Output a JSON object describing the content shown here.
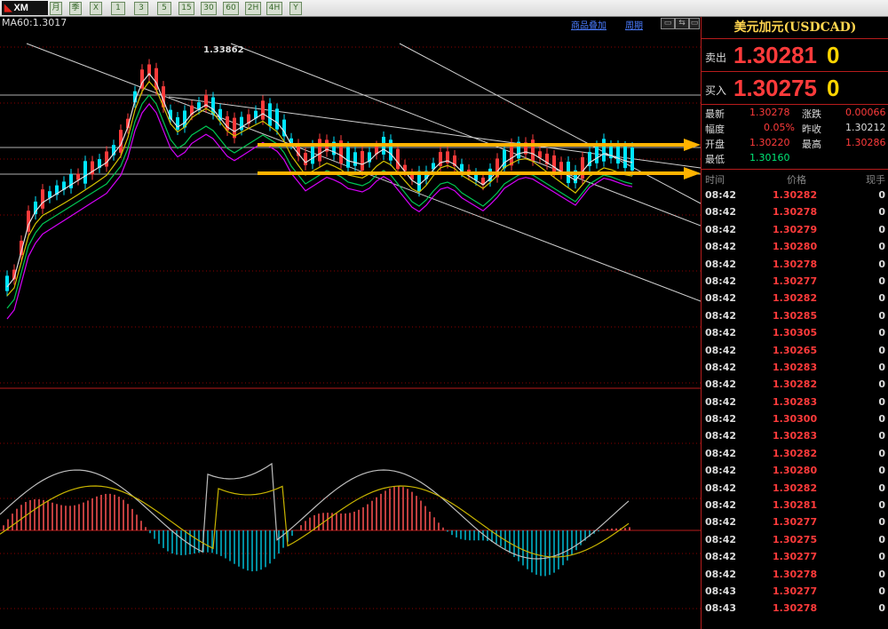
{
  "toolbar": {
    "logo_text": "XM",
    "buttons": [
      "月",
      "季",
      "X",
      "1",
      "3",
      "5",
      "15",
      "30",
      "60",
      "2H",
      "4H",
      "Y"
    ]
  },
  "chart": {
    "ma_label": "MA60:1.3017",
    "peak_label": "1.33862",
    "link_add_product": "商品叠加",
    "link_cycle": "周期",
    "colors": {
      "up_candle": "#00e5ff",
      "down_candle": "#ff3b3b",
      "arrow": "#ffb300",
      "grid": "#8b0000",
      "hline": "#b0b0b0"
    }
  },
  "panel": {
    "title": "美元加元(USDCAD)",
    "sell_label": "卖出",
    "sell_price": "1.30281",
    "sell_size": "0",
    "buy_label": "买入",
    "buy_price": "1.30275",
    "buy_size": "0",
    "stats": {
      "latest_label": "最新",
      "latest_value": "1.30278",
      "change_label": "涨跌",
      "change_value": "0.00066",
      "amplitude_label": "幅度",
      "amplitude_value": "0.05%",
      "prev_close_label": "昨收",
      "prev_close_value": "1.30212",
      "open_label": "开盘",
      "open_value": "1.30220",
      "high_label": "最高",
      "high_value": "1.30286",
      "low_label": "最低",
      "low_value": "1.30160"
    },
    "tick_headers": {
      "time": "时间",
      "price": "价格",
      "volume": "现手"
    },
    "ticks": [
      {
        "time": "08:42",
        "price": "1.30282",
        "vol": "0"
      },
      {
        "time": "08:42",
        "price": "1.30278",
        "vol": "0"
      },
      {
        "time": "08:42",
        "price": "1.30279",
        "vol": "0"
      },
      {
        "time": "08:42",
        "price": "1.30280",
        "vol": "0"
      },
      {
        "time": "08:42",
        "price": "1.30278",
        "vol": "0"
      },
      {
        "time": "08:42",
        "price": "1.30277",
        "vol": "0"
      },
      {
        "time": "08:42",
        "price": "1.30282",
        "vol": "0"
      },
      {
        "time": "08:42",
        "price": "1.30285",
        "vol": "0"
      },
      {
        "time": "08:42",
        "price": "1.30305",
        "vol": "0"
      },
      {
        "time": "08:42",
        "price": "1.30265",
        "vol": "0"
      },
      {
        "time": "08:42",
        "price": "1.30283",
        "vol": "0"
      },
      {
        "time": "08:42",
        "price": "1.30282",
        "vol": "0"
      },
      {
        "time": "08:42",
        "price": "1.30283",
        "vol": "0"
      },
      {
        "time": "08:42",
        "price": "1.30300",
        "vol": "0"
      },
      {
        "time": "08:42",
        "price": "1.30283",
        "vol": "0"
      },
      {
        "time": "08:42",
        "price": "1.30282",
        "vol": "0"
      },
      {
        "time": "08:42",
        "price": "1.30280",
        "vol": "0"
      },
      {
        "time": "08:42",
        "price": "1.30282",
        "vol": "0"
      },
      {
        "time": "08:42",
        "price": "1.30281",
        "vol": "0"
      },
      {
        "time": "08:42",
        "price": "1.30277",
        "vol": "0"
      },
      {
        "time": "08:42",
        "price": "1.30275",
        "vol": "0"
      },
      {
        "time": "08:42",
        "price": "1.30277",
        "vol": "0"
      },
      {
        "time": "08:42",
        "price": "1.30278",
        "vol": "0"
      },
      {
        "time": "08:43",
        "price": "1.30277",
        "vol": "0"
      },
      {
        "time": "08:43",
        "price": "1.30278",
        "vol": "0"
      }
    ]
  }
}
